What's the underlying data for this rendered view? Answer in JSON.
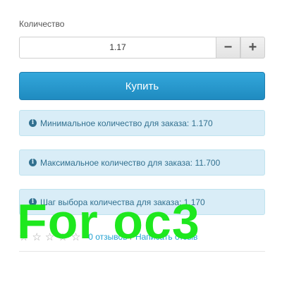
{
  "quantity": {
    "label": "Количество",
    "value": "1.17",
    "minus_label": "−",
    "plus_label": "+"
  },
  "buy_button": {
    "label": "Купить"
  },
  "alerts": [
    {
      "icon": "info-circle-icon",
      "text": "Минимальное количество для заказа: 1.170"
    },
    {
      "icon": "info-circle-icon",
      "text": "Максимальное количество для заказа: 11.700"
    },
    {
      "icon": "info-circle-icon",
      "text": "Шаг выбора количества для заказа: 1.170"
    }
  ],
  "rating": {
    "stars_filled": 0,
    "stars_total": 5,
    "reviews_link": "0 отзывов",
    "separator": "/",
    "write_review_link": "Написать отзыв"
  },
  "overlay": {
    "text": "For oc3",
    "color": "#1ee81e"
  },
  "colors": {
    "accent": "#229ac8",
    "alert_bg": "#d9edf7",
    "alert_text": "#31708f",
    "link": "#23a1d1"
  }
}
